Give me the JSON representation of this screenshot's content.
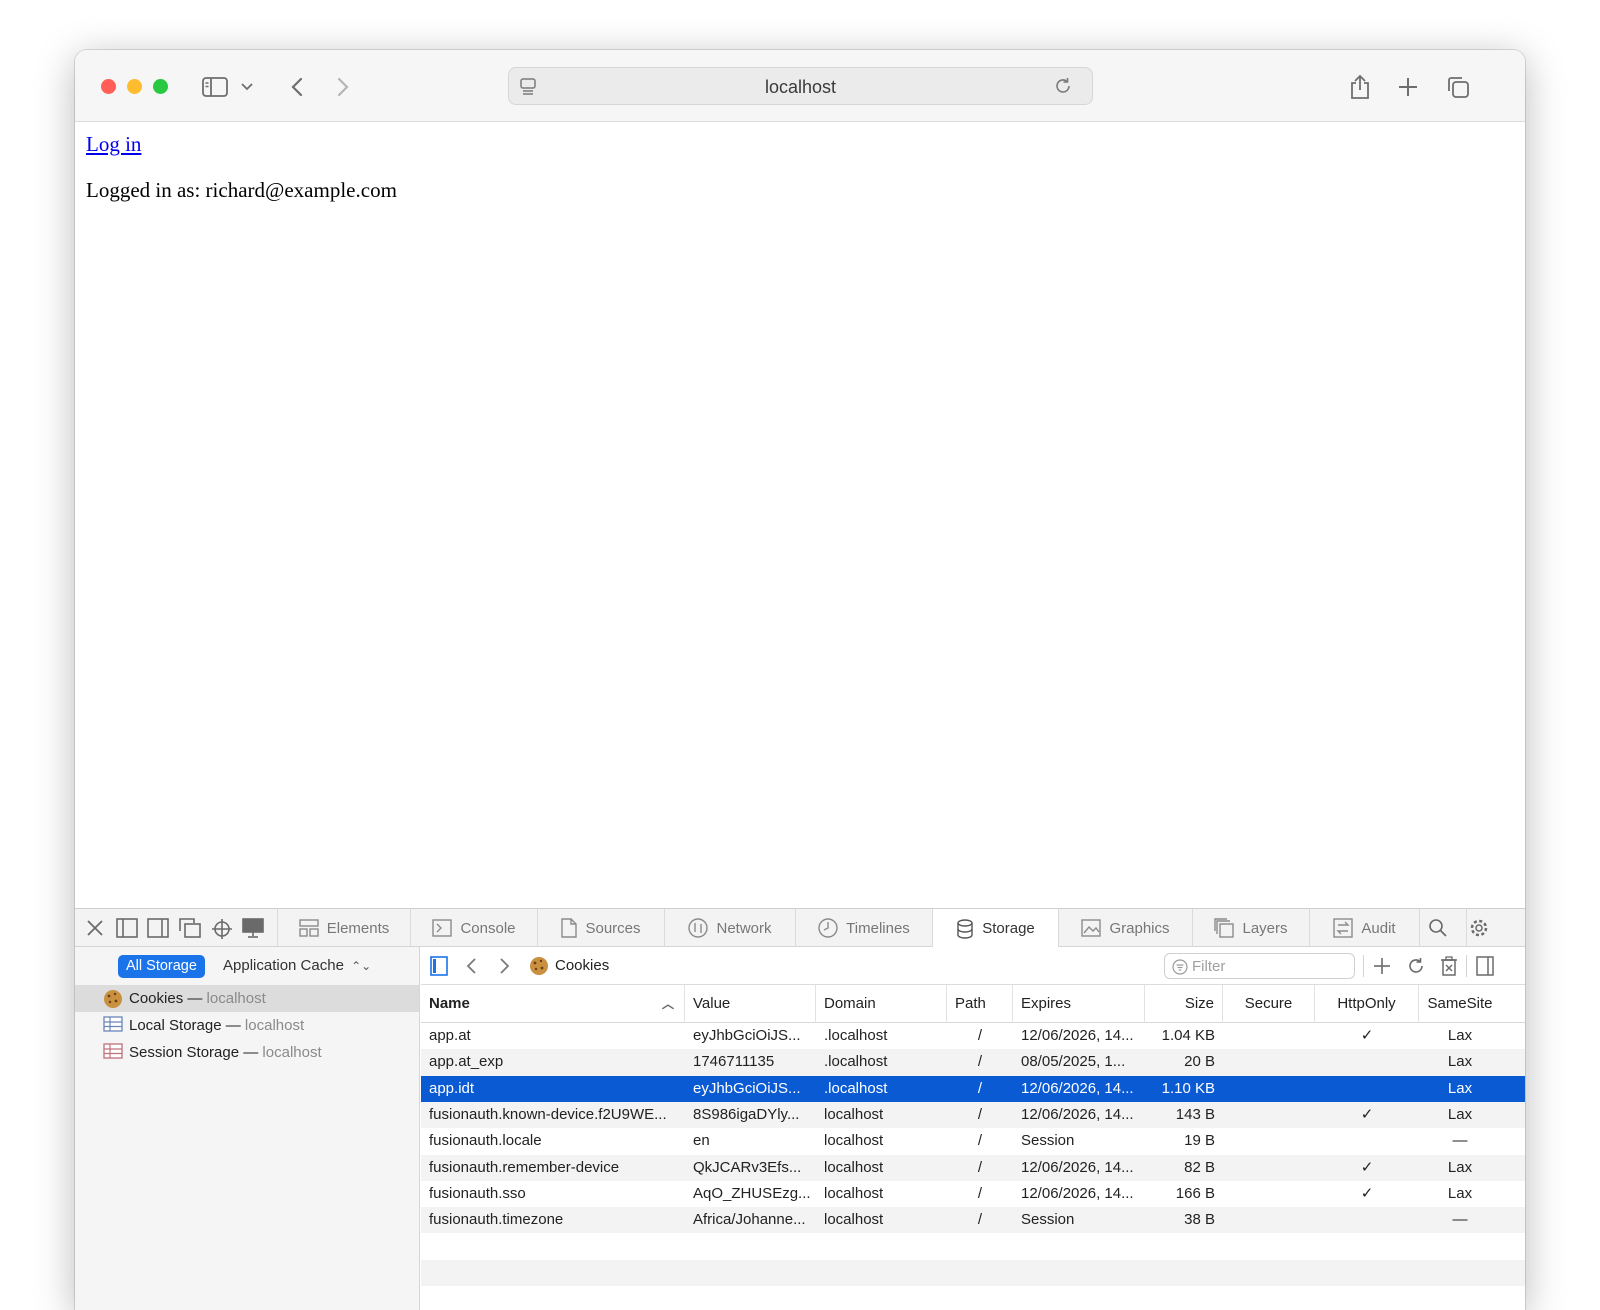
{
  "browser": {
    "url": "localhost",
    "traffic_lights": {
      "close": "#ff5f57",
      "minimize": "#febc2e",
      "zoom": "#28c840"
    }
  },
  "page": {
    "login_link": "Log in",
    "logged_in_text": "Logged in as: richard@example.com"
  },
  "devtools": {
    "tabs": [
      {
        "label": "Elements",
        "icon": "elements-icon"
      },
      {
        "label": "Console",
        "icon": "console-icon"
      },
      {
        "label": "Sources",
        "icon": "sources-icon"
      },
      {
        "label": "Network",
        "icon": "network-icon"
      },
      {
        "label": "Timelines",
        "icon": "timelines-icon"
      },
      {
        "label": "Storage",
        "icon": "storage-icon",
        "active": true
      },
      {
        "label": "Graphics",
        "icon": "graphics-icon"
      },
      {
        "label": "Layers",
        "icon": "layers-icon"
      },
      {
        "label": "Audit",
        "icon": "audit-icon"
      }
    ],
    "sidebar": {
      "scope_selected": "All Storage",
      "scope_dropdown": "Application Cache",
      "items": [
        {
          "label": "Cookies",
          "host": "localhost",
          "selected": true
        },
        {
          "label": "Local Storage",
          "host": "localhost"
        },
        {
          "label": "Session Storage",
          "host": "localhost"
        }
      ]
    },
    "content": {
      "breadcrumb": "Cookies",
      "filter_placeholder": "Filter",
      "columns": [
        "Name",
        "Value",
        "Domain",
        "Path",
        "Expires",
        "Size",
        "Secure",
        "HttpOnly",
        "SameSite"
      ],
      "sorted_column_indicator": "^",
      "rows": [
        {
          "name": "app.at",
          "value": "eyJhbGciOiJS...",
          "domain": ".localhost",
          "path": "/",
          "expires": "12/06/2026, 14...",
          "size": "1.04 KB",
          "secure": "",
          "httponly": "✓",
          "samesite": "Lax"
        },
        {
          "name": "app.at_exp",
          "value": "1746711135",
          "domain": ".localhost",
          "path": "/",
          "expires": "08/05/2025, 1...",
          "size": "20 B",
          "secure": "",
          "httponly": "",
          "samesite": "Lax"
        },
        {
          "name": "app.idt",
          "value": "eyJhbGciOiJS...",
          "domain": ".localhost",
          "path": "/",
          "expires": "12/06/2026, 14...",
          "size": "1.10 KB",
          "secure": "",
          "httponly": "",
          "samesite": "Lax",
          "selected": true
        },
        {
          "name": "fusionauth.known-device.f2U9WE...",
          "value": "8S986igaDYly...",
          "domain": "localhost",
          "path": "/",
          "expires": "12/06/2026, 14...",
          "size": "143 B",
          "secure": "",
          "httponly": "✓",
          "samesite": "Lax"
        },
        {
          "name": "fusionauth.locale",
          "value": "en",
          "domain": "localhost",
          "path": "/",
          "expires": "Session",
          "size": "19 B",
          "secure": "",
          "httponly": "",
          "samesite": "—"
        },
        {
          "name": "fusionauth.remember-device",
          "value": "QkJCARv3Efs...",
          "domain": "localhost",
          "path": "/",
          "expires": "12/06/2026, 14...",
          "size": "82 B",
          "secure": "",
          "httponly": "✓",
          "samesite": "Lax"
        },
        {
          "name": "fusionauth.sso",
          "value": "AqO_ZHUSEzg...",
          "domain": "localhost",
          "path": "/",
          "expires": "12/06/2026, 14...",
          "size": "166 B",
          "secure": "",
          "httponly": "✓",
          "samesite": "Lax"
        },
        {
          "name": "fusionauth.timezone",
          "value": "Africa/Johanne...",
          "domain": "localhost",
          "path": "/",
          "expires": "Session",
          "size": "38 B",
          "secure": "",
          "httponly": "",
          "samesite": "—"
        }
      ]
    }
  }
}
